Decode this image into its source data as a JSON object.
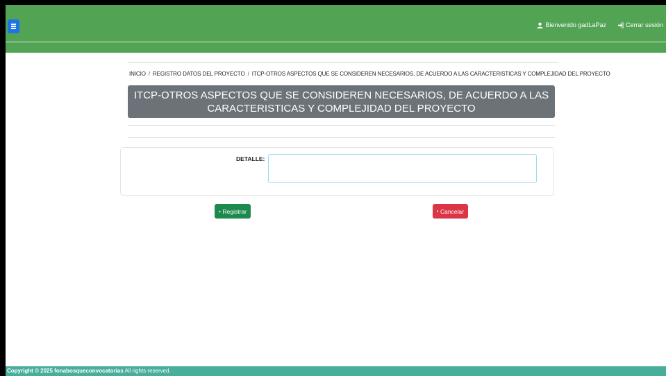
{
  "header": {
    "menu_icon": "hamburger-icon",
    "user_label": "Bienvenido gadLaPaz",
    "user_icon": "user-icon",
    "logout_label": "Cerrar sesión",
    "logout_icon": "sign-out-icon",
    "color": "#53a355"
  },
  "breadcrumb": {
    "items": [
      "INICIO",
      "REGISTRO DATOS DEL PROYECTO",
      "ITCP-OTROS ASPECTOS QUE SE CONSIDEREN NECESARIOS, DE ACUERDO A LAS CARACTERISTICAS Y COMPLEJIDAD DEL PROYECTO"
    ],
    "separator": "/"
  },
  "page": {
    "title": "ITCP-OTROS ASPECTOS QUE SE CONSIDEREN NECESARIOS, DE ACUERDO A LAS CARACTERISTICAS Y COMPLEJIDAD DEL PROYECTO"
  },
  "form": {
    "detalle_label": "DETALLE:",
    "detalle_value": ""
  },
  "actions": {
    "registrar_label": "Registrar",
    "registrar_icon": "save-icon",
    "registrar_color": "#1c8a4d",
    "cancelar_label": "Cancelar",
    "cancelar_icon": "trash-icon",
    "cancelar_color": "#dc3545"
  },
  "footer": {
    "copyright_bold": "Copyright © 2025 fonabosqueconvocatorias",
    "copyright_rest": " All rights reserved.",
    "color": "#48ad9b"
  }
}
